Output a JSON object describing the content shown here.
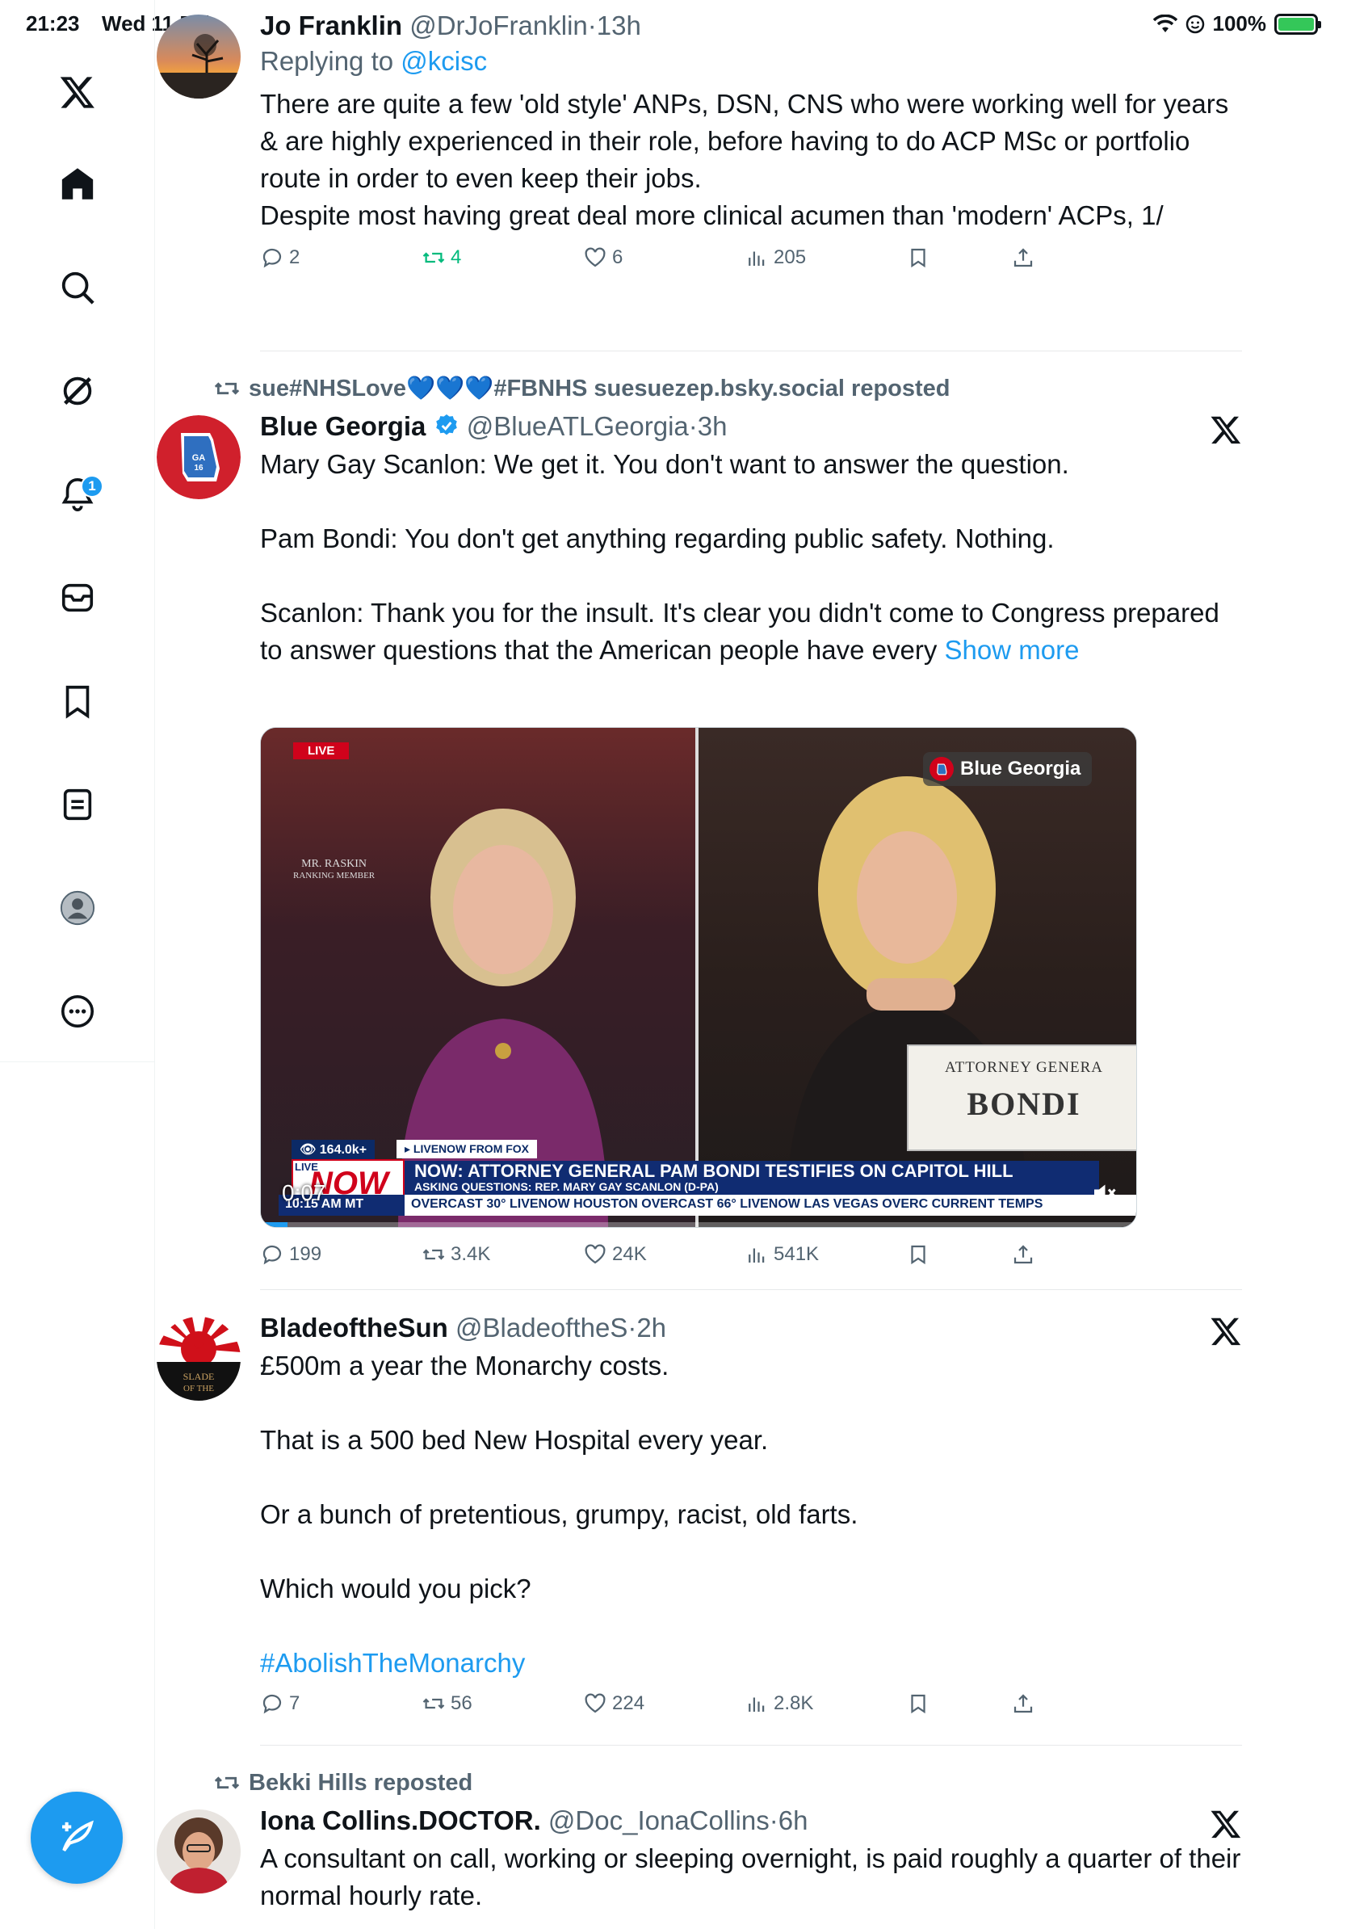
{
  "status_bar": {
    "time": "21:23",
    "date": "Wed 11 Feb",
    "battery": "100%",
    "battery_level": 1.0
  },
  "sidebar": {
    "items": [
      {
        "name": "x-logo-icon"
      },
      {
        "name": "home-icon"
      },
      {
        "name": "search-icon"
      },
      {
        "name": "grok-icon"
      },
      {
        "name": "notifications-icon",
        "badge": "1"
      },
      {
        "name": "messages-icon"
      },
      {
        "name": "bookmarks-icon"
      },
      {
        "name": "lists-icon"
      },
      {
        "name": "profile-icon"
      },
      {
        "name": "more-icon"
      }
    ],
    "compose_icon": "compose-icon"
  },
  "tweets": [
    {
      "name": "Jo Franklin",
      "handle": "@DrJoFranklin",
      "time": "13h",
      "reply_prefix": "Replying to",
      "reply_to": "@kcisc",
      "text_lines": [
        "There are quite a few 'old style' ANPs, DSN, CNS who were working well for years & are highly experienced in their role, before having to do ACP MSc or portfolio route in order to even keep their jobs.",
        "Despite most having great deal more clinical acumen than 'modern' ACPs, 1/"
      ],
      "replies": "2",
      "reposts": "4",
      "likes": "6",
      "views": "205"
    },
    {
      "repost_by": "sue#NHSLove💙💙💙#FBNHS suesuezep.bsky.social reposted",
      "name": "Blue Georgia",
      "handle": "@BlueATLGeorgia",
      "time": "3h",
      "verified": true,
      "text_lines": [
        "Mary Gay Scanlon: We get it. You don't want to answer the question.",
        "Pam Bondi: You don't get anything regarding public safety. Nothing.",
        "Scanlon: Thank you for the insult. It's clear you didn't come to Congress prepared to answer questions that the American people have every"
      ],
      "show_more": "Show more",
      "video": {
        "live": "LIVE",
        "raskin": "MR. RASKIN",
        "raskin_sub": "RANKING MEMBER",
        "brand": "Blue Georgia",
        "plate_line1": "ATTORNEY GENERA",
        "plate_line2": "BONDI",
        "views": "164.0k+",
        "source": "▸ LIVENOW FROM FOX",
        "headline": "NOW: ATTORNEY GENERAL PAM BONDI TESTIFIES ON CAPITOL HILL",
        "subheadline": "ASKING QUESTIONS: REP. MARY GAY SCANLON (D-PA)",
        "live_small": "LIVE",
        "now": "NOW",
        "clock": "10:15 AM MT",
        "ticker": "OVERCAST 30°  LIVENOW  HOUSTON  OVERCAST 66°  LIVENOW  LAS VEGAS  OVERC  CURRENT TEMPS",
        "timer": "0:07",
        "progress": 0.03
      },
      "replies": "199",
      "reposts": "3.4K",
      "likes": "24K",
      "views": "541K"
    },
    {
      "name": "BladeoftheSun",
      "handle": "@BladeoftheS",
      "time": "2h",
      "text_lines": [
        "£500m a year the Monarchy costs.",
        "That is a 500 bed New Hospital every year.",
        "Or a bunch of pretentious, grumpy, racist, old farts.",
        "Which would you pick?"
      ],
      "hashtag": "#AbolishTheMonarchy",
      "replies": "7",
      "reposts": "56",
      "likes": "224",
      "views": "2.8K"
    },
    {
      "repost_by": "Bekki Hills reposted",
      "name": "Iona Collins.DOCTOR.",
      "handle": "@Doc_IonaCollins",
      "time": "6h",
      "text_lines": [
        "A consultant on call, working or sleeping overnight, is paid roughly a quarter of their normal hourly rate."
      ]
    }
  ],
  "separator": "·",
  "colors": {
    "accent": "#1d9bf0",
    "repost_green": "#00ba7c",
    "muted": "#536471",
    "text": "#0f1419"
  }
}
